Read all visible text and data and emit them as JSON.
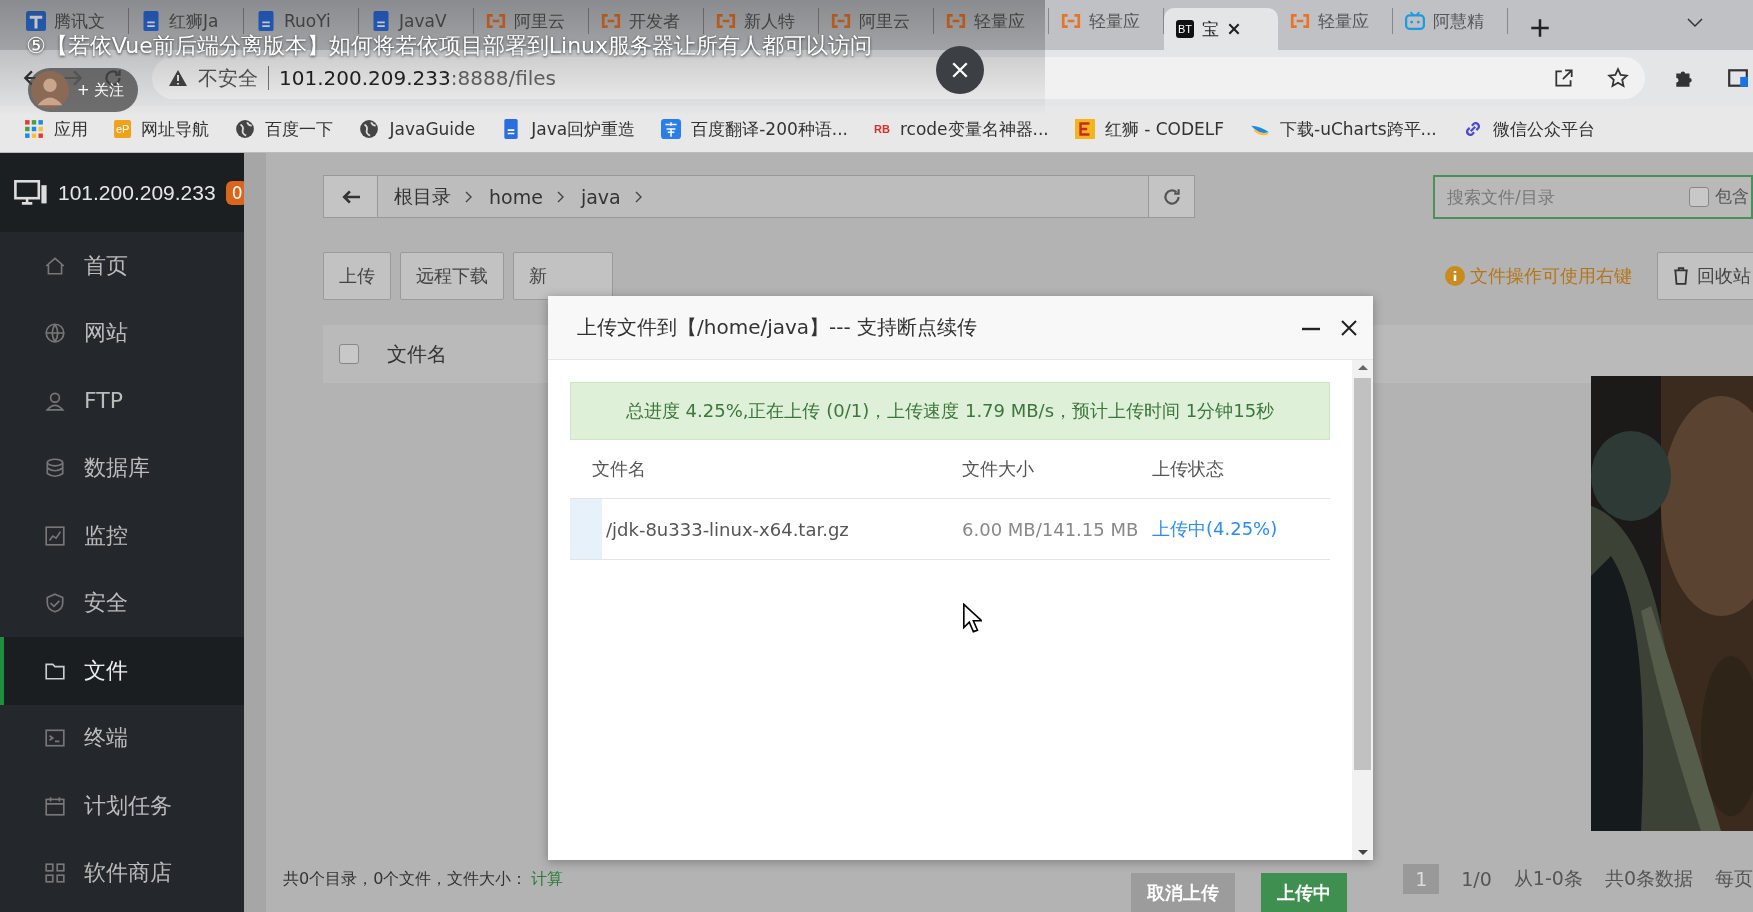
{
  "video_overlay": {
    "title": "⑤【若依Vue前后端分离版本】如何将若依项目部署到Linux服务器让所有人都可以访问",
    "follow_label": "+ 关注"
  },
  "browser": {
    "tabs": [
      {
        "label": "腾讯文",
        "kind": "tencent",
        "selected": false
      },
      {
        "label": "红狮Ja",
        "kind": "doc",
        "selected": false
      },
      {
        "label": "RuoYi",
        "kind": "doc",
        "selected": false
      },
      {
        "label": "JavaV",
        "kind": "doc",
        "selected": false
      },
      {
        "label": "阿里云",
        "kind": "bracket",
        "selected": false
      },
      {
        "label": "开发者",
        "kind": "bracket",
        "selected": false
      },
      {
        "label": "新人特",
        "kind": "bracket",
        "selected": false
      },
      {
        "label": "阿里云",
        "kind": "bracket",
        "selected": false
      },
      {
        "label": "轻量应",
        "kind": "bracket",
        "selected": false
      },
      {
        "label": "轻量应",
        "kind": "bracket",
        "selected": false
      },
      {
        "label": "宝",
        "kind": "lettered",
        "logo_text": "BT",
        "selected": true
      },
      {
        "label": "轻量应",
        "kind": "bracket",
        "selected": false
      },
      {
        "label": "阿慧精",
        "kind": "tv",
        "selected": false
      }
    ],
    "security": "不安全",
    "url_host": "101.200.209.233",
    "url_rest": ":8888/files",
    "bookmarks": [
      {
        "label": "应用",
        "kind": "apps"
      },
      {
        "label": "网址导航",
        "kind": "lettered",
        "logo_text": "eP"
      },
      {
        "label": "百度一下",
        "kind": "globe"
      },
      {
        "label": "JavaGuide",
        "kind": "globe"
      },
      {
        "label": "Java回炉重造",
        "kind": "doc"
      },
      {
        "label": "百度翻译-200种语...",
        "kind": "translate"
      },
      {
        "label": "rcode变量名神器...",
        "kind": "redtext",
        "logo_text": "RB"
      },
      {
        "label": "红狮 - CODELF",
        "kind": "codelf"
      },
      {
        "label": "下载-uCharts跨平...",
        "kind": "bird"
      },
      {
        "label": "微信公众平台",
        "kind": "link"
      }
    ]
  },
  "sidebar": {
    "host": "101.200.209.233",
    "badge": "0",
    "items": [
      {
        "label": "首页",
        "kind": "home",
        "selected": false
      },
      {
        "label": "网站",
        "kind": "globe",
        "selected": false
      },
      {
        "label": "FTP",
        "kind": "ftp",
        "selected": false
      },
      {
        "label": "数据库",
        "kind": "db",
        "selected": false
      },
      {
        "label": "监控",
        "kind": "monitor",
        "selected": false
      },
      {
        "label": "安全",
        "kind": "shield",
        "selected": false
      },
      {
        "label": "文件",
        "kind": "folder",
        "selected": true
      },
      {
        "label": "终端",
        "kind": "terminal",
        "selected": false
      },
      {
        "label": "计划任务",
        "kind": "calendar",
        "selected": false
      },
      {
        "label": "软件商店",
        "kind": "grid",
        "selected": false
      }
    ]
  },
  "files": {
    "breadcrumb": [
      "根目录",
      "home",
      "java"
    ],
    "search_placeholder": "搜索文件/目录",
    "include_label": "包含",
    "include_checked": false,
    "toolbar": [
      "上传",
      "远程下载",
      "新"
    ],
    "hint": "文件操作可使用右键",
    "recycle": "回收站",
    "table_header": "文件名",
    "select_all_checked": false,
    "summary": "共0个目录，0个文件，文件大小：",
    "summary_link": "计算",
    "pagination": [
      "1",
      "1/0",
      "从1-0条",
      "共0条数据",
      "每页"
    ]
  },
  "upload_dialog": {
    "title": "上传文件到【/home/java】--- 支持断点续传",
    "progress": "总进度 4.25%,正在上传 (0/1)，上传速度 1.79 MB/s，预计上传时间 1分钟15秒",
    "columns": [
      "文件名",
      "文件大小",
      "上传状态"
    ],
    "rows": [
      {
        "name": "/jdk-8u333-linux-x64.tar.gz",
        "size": "6.00 MB/141.15 MB",
        "status": "上传中(4.25%)",
        "level": 0.0425
      }
    ],
    "buttons": [
      {
        "label": "取消上传",
        "kind": "cancel"
      },
      {
        "label": "上传中",
        "kind": "primary"
      }
    ]
  }
}
